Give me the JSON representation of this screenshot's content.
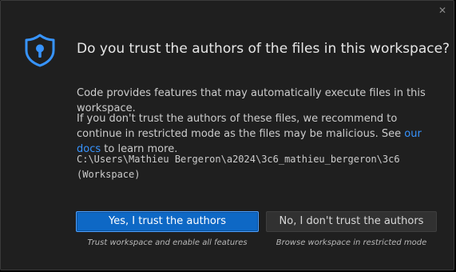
{
  "dialog": {
    "close_icon": "close-icon",
    "shield_icon": "shield-lock-icon",
    "title": "Do you trust the authors of the files in this workspace?",
    "paragraph1": "Code provides features that may automatically execute files in this workspace.",
    "paragraph2_before": "If you don't trust the authors of these files, we recommend to continue in restricted mode as the files may be malicious. See ",
    "docs_link": "our docs",
    "paragraph2_after": " to learn more.",
    "path_line1": "C:\\Users\\Mathieu Bergeron\\a2024\\3c6_mathieu_bergeron\\3c6",
    "path_line2": "(Workspace)"
  },
  "buttons": {
    "trust_label": "Yes, I trust the authors",
    "trust_caption": "Trust workspace and enable all features",
    "restricted_label": "No, I don't trust the authors",
    "restricted_caption": "Browse workspace in restricted mode"
  },
  "colors": {
    "background": "#1f1f1f",
    "accent": "#0e68c5",
    "link": "#3794ff",
    "shield": "#3794ff"
  }
}
